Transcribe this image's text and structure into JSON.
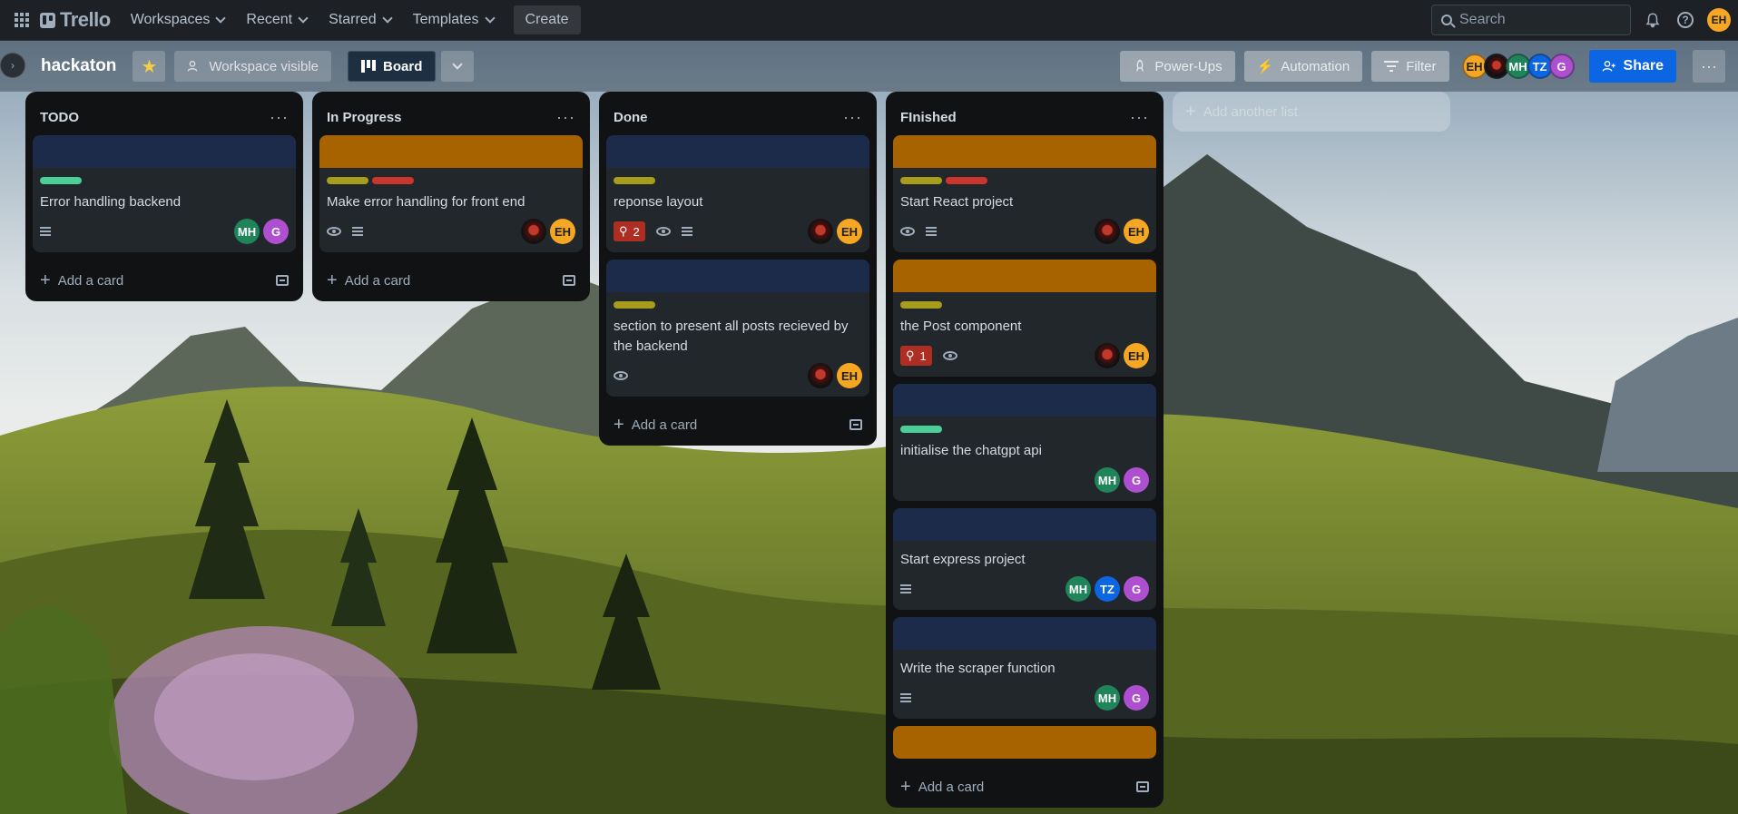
{
  "nav": {
    "logo": "Trello",
    "items": [
      {
        "label": "Workspaces"
      },
      {
        "label": "Recent"
      },
      {
        "label": "Starred"
      },
      {
        "label": "Templates"
      }
    ],
    "create": "Create",
    "search_placeholder": "Search",
    "user_initials": "EH"
  },
  "board": {
    "title": "hackaton",
    "visibility": "Workspace visible",
    "view": "Board",
    "power_ups": "Power-Ups",
    "automation": "Automation",
    "filter": "Filter",
    "share": "Share",
    "members": [
      "EH",
      "",
      "MH",
      "TZ",
      "G"
    ]
  },
  "lists": [
    {
      "title": "TODO",
      "add_card": "Add a card",
      "cards": [
        {
          "cover": "#1c2b4a",
          "labels": [
            "#4bce97"
          ],
          "title": "Error handling backend",
          "desc": true,
          "watch": false,
          "pins": "",
          "avatars": [
            "MH",
            "G"
          ]
        }
      ]
    },
    {
      "title": "In Progress",
      "add_card": "Add a card",
      "cards": [
        {
          "cover": "#a66300",
          "labels": [
            "#a89c1d",
            "#c9372c"
          ],
          "title": "Make error handling for front end",
          "desc": true,
          "watch": true,
          "pins": "",
          "avatars": [
            "",
            "EH"
          ]
        }
      ]
    },
    {
      "title": "Done",
      "add_card": "Add a card",
      "cards": [
        {
          "cover": "#1c2b4a",
          "labels": [
            "#a89c1d"
          ],
          "title": "reponse layout",
          "desc": true,
          "watch": true,
          "pins": "2",
          "avatars": [
            "",
            "EH"
          ]
        },
        {
          "cover": "#1c2b4a",
          "labels": [
            "#a89c1d"
          ],
          "title": "section to present all posts recieved by the backend",
          "desc": false,
          "watch": true,
          "pins": "",
          "avatars": [
            "",
            "EH"
          ]
        }
      ]
    },
    {
      "title": "FInished",
      "add_card": "Add a card",
      "cards": [
        {
          "cover": "#a66300",
          "labels": [
            "#a89c1d",
            "#c9372c"
          ],
          "title": "Start React project",
          "desc": true,
          "watch": true,
          "pins": "",
          "avatars": [
            "",
            "EH"
          ]
        },
        {
          "cover": "#a66300",
          "labels": [
            "#a89c1d"
          ],
          "title": "the Post component",
          "desc": false,
          "watch": true,
          "pins": "1",
          "avatars": [
            "",
            "EH"
          ]
        },
        {
          "cover": "#1c2b4a",
          "labels": [
            "#4bce97"
          ],
          "title": "initialise the chatgpt api",
          "desc": false,
          "watch": false,
          "pins": "",
          "avatars": [
            "MH",
            "G"
          ]
        },
        {
          "cover": "#1c2b4a",
          "labels": [],
          "title": "Start express project",
          "desc": true,
          "watch": false,
          "pins": "",
          "avatars": [
            "MH",
            "TZ",
            "G"
          ]
        },
        {
          "cover": "#1c2b4a",
          "labels": [],
          "title": "Write the scraper function",
          "desc": true,
          "watch": false,
          "pins": "",
          "avatars": [
            "MH",
            "G"
          ]
        },
        {
          "cover": "#a66300",
          "labels": [],
          "title": "",
          "desc": false,
          "watch": false,
          "pins": "",
          "avatars": [],
          "cover_only": true
        }
      ]
    }
  ],
  "add_list": "Add another list"
}
